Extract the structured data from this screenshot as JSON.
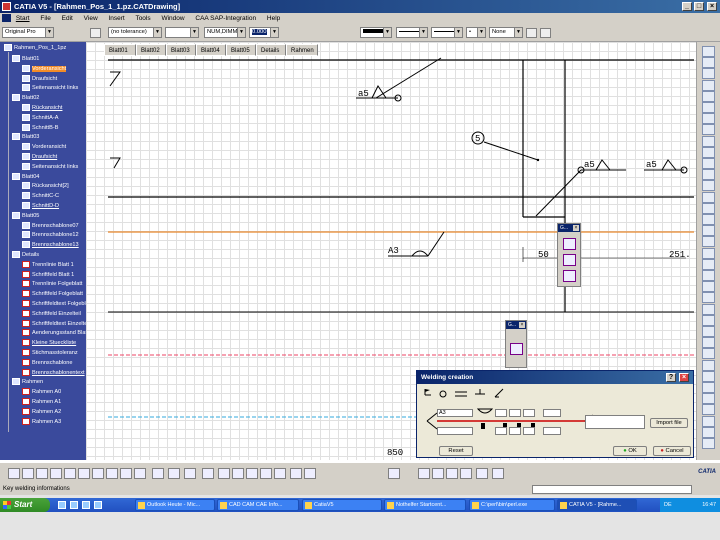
{
  "window": {
    "title": "CATIA V5 - [Rahmen_Pos_1_1.pz.CATDrawing]"
  },
  "menu": [
    "Start",
    "File",
    "Edit",
    "View",
    "Insert",
    "Tools",
    "Window",
    "CAA SAP-Integration",
    "Help"
  ],
  "toolbar": {
    "style_combo": "Original Pro",
    "tolerance_combo": "(no tolerance)",
    "num_combo": "NUM,DIMM",
    "precision_combo": "0.000",
    "none_combo": "None"
  },
  "tree": {
    "root": "Rahmen_Pos_1_1pz",
    "items": [
      {
        "label": "Blatt01",
        "level": 1
      },
      {
        "label": "Vorderansicht",
        "level": 2,
        "selected": true
      },
      {
        "label": "Draufsicht",
        "level": 2
      },
      {
        "label": "Seitenansicht links",
        "level": 2
      },
      {
        "label": "Blatt02",
        "level": 1
      },
      {
        "label": "Rückansicht",
        "level": 2,
        "underline": true
      },
      {
        "label": "SchnittA-A",
        "level": 2
      },
      {
        "label": "SchnittB-B",
        "level": 2
      },
      {
        "label": "Blatt03",
        "level": 1
      },
      {
        "label": "Vorderansicht",
        "level": 2
      },
      {
        "label": "Draufsicht",
        "level": 2,
        "underline": true
      },
      {
        "label": "Seitenansicht links",
        "level": 2
      },
      {
        "label": "Blatt04",
        "level": 1
      },
      {
        "label": "Rückansicht[2]",
        "level": 2
      },
      {
        "label": "SchnittC-C",
        "level": 2
      },
      {
        "label": "SchnittD-D",
        "level": 2,
        "underline": true
      },
      {
        "label": "Blatt05",
        "level": 1
      },
      {
        "label": "Brennschablone07",
        "level": 2
      },
      {
        "label": "Brennschablone12",
        "level": 2
      },
      {
        "label": "Brennschablone13",
        "level": 2,
        "underline": true
      },
      {
        "label": "Details",
        "level": 1
      },
      {
        "label": "Trennlinie Blatt 1",
        "level": 2,
        "det": true
      },
      {
        "label": "Schriftfeld Blatt 1",
        "level": 2,
        "det": true
      },
      {
        "label": "Trennlinie Folgeblatt",
        "level": 2,
        "det": true
      },
      {
        "label": "Schriftfeld Folgeblatt",
        "level": 2,
        "det": true
      },
      {
        "label": "Schriftfeldtext Folgeblatt",
        "level": 2,
        "det": true
      },
      {
        "label": "Schriftfeld Einzelteil",
        "level": 2,
        "det": true
      },
      {
        "label": "Schriftfeldtext Einzelteil",
        "level": 2,
        "det": true
      },
      {
        "label": "Aenderungsstand Blatt",
        "level": 2,
        "det": true
      },
      {
        "label": "Kleine Stueckliste",
        "level": 2,
        "det": true,
        "underline": true
      },
      {
        "label": "Stichmasstoleranz",
        "level": 2,
        "det": true
      },
      {
        "label": "Brennschablone",
        "level": 2,
        "det": true
      },
      {
        "label": "Brennschablonentext",
        "level": 2,
        "det": true,
        "underline": true
      },
      {
        "label": "Rahmen",
        "level": 1
      },
      {
        "label": "Rahmen A0",
        "level": 2,
        "det": true
      },
      {
        "label": "Rahmen A1",
        "level": 2,
        "det": true
      },
      {
        "label": "Rahmen A2",
        "level": 2,
        "det": true
      },
      {
        "label": "Rahmen A3",
        "level": 2,
        "det": true
      }
    ]
  },
  "sheet_tabs": [
    "Blatt01",
    "Blatt02",
    "Blatt03",
    "Blatt04",
    "Blatt05",
    "Details",
    "Rahmen"
  ],
  "drawing": {
    "weld_labels": [
      "a5",
      "a5",
      "a5",
      "A3"
    ],
    "balloon": "5",
    "dims": [
      "50",
      "251.",
      "850"
    ]
  },
  "palettes": [
    {
      "title": "G..."
    },
    {
      "title": "G..."
    }
  ],
  "weld_dialog": {
    "title": "Welding creation",
    "field_value": "A3",
    "import_button": "Import file",
    "reset_button": "Reset",
    "ok_button": "OK",
    "cancel_button": "Cancel"
  },
  "status": {
    "text": "Key welding informations"
  },
  "taskbar": {
    "start": "Start",
    "tasks": [
      "Outlook Heute - Mic...",
      "CAD CAM CAE Info...",
      "CatiaV5",
      "Nothelfer Startcent...",
      "C:\\perl\\bin\\perl.exe",
      "CATIA V5 - [Rahme..."
    ],
    "tray": "DE",
    "clock": "16:47"
  },
  "brand": "CATIA"
}
